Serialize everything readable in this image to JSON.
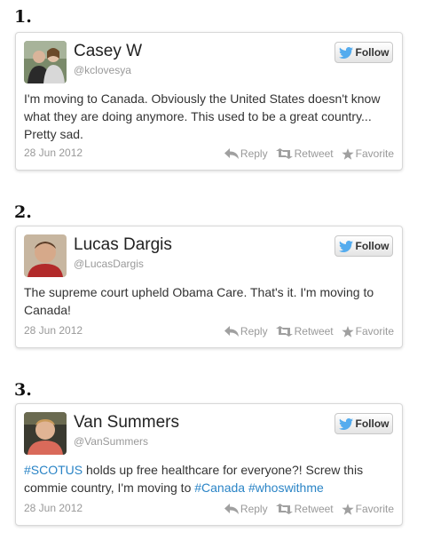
{
  "tweets": [
    {
      "number": "1.",
      "name": "Casey W",
      "handle": "@kclovesya",
      "segments": [
        {
          "text": "I'm moving to Canada. Obviously the United States doesn't know what they are doing anymore. This used to be a great country... Pretty sad.",
          "type": "text"
        }
      ],
      "date": "28 Jun 2012",
      "follow_label": "Follow",
      "reply_label": "Reply",
      "retweet_label": "Retweet",
      "favorite_label": "Favorite"
    },
    {
      "number": "2.",
      "name": "Lucas Dargis",
      "handle": "@LucasDargis",
      "segments": [
        {
          "text": "The supreme court upheld Obama Care. That's it. I'm moving to Canada!",
          "type": "text"
        }
      ],
      "date": "28 Jun 2012",
      "follow_label": "Follow",
      "reply_label": "Reply",
      "retweet_label": "Retweet",
      "favorite_label": "Favorite"
    },
    {
      "number": "3.",
      "name": "Van Summers",
      "handle": "@VanSummers",
      "segments": [
        {
          "text": "#SCOTUS",
          "type": "hashtag"
        },
        {
          "text": " holds up free healthcare for everyone?! Screw this commie country, I'm moving to ",
          "type": "text"
        },
        {
          "text": "#Canada",
          "type": "hashtag"
        },
        {
          "text": " ",
          "type": "text"
        },
        {
          "text": "#whoswithme",
          "type": "hashtag"
        }
      ],
      "date": "28 Jun 2012",
      "follow_label": "Follow",
      "reply_label": "Reply",
      "retweet_label": "Retweet",
      "favorite_label": "Favorite"
    }
  ],
  "colors": {
    "hashtag": "#2a84c6",
    "twitter_bird": "#55acee",
    "meta_gray": "#999999"
  },
  "icons": {
    "follow": "twitter-bird-icon",
    "reply": "reply-arrow-icon",
    "retweet": "retweet-icon",
    "favorite": "star-icon"
  }
}
